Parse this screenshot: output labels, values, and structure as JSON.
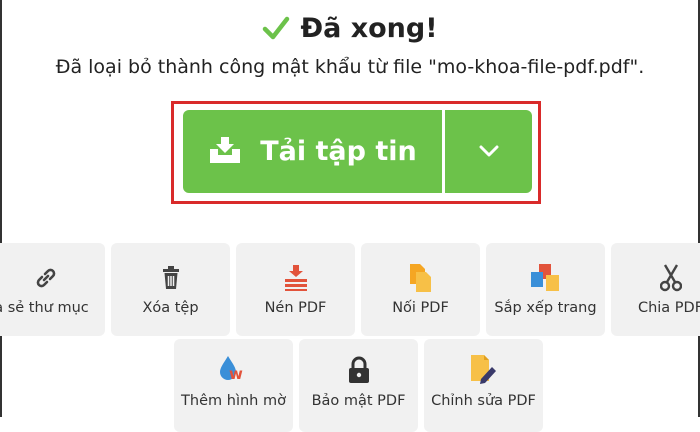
{
  "header": {
    "title": "Đã xong!",
    "message": "Đã loại bỏ thành công mật khẩu từ file \"mo-khoa-file-pdf.pdf\"."
  },
  "download": {
    "label": "Tải tập tin",
    "icon": "download-tray-icon",
    "dropdown_icon": "chevron-down-icon",
    "color": "#6cc24a",
    "highlight_color": "#d92a2a"
  },
  "tools_row1": [
    {
      "label": "hia sẻ thư mục",
      "icon": "link-icon"
    },
    {
      "label": "Xóa tệp",
      "icon": "trash-icon"
    },
    {
      "label": "Nén PDF",
      "icon": "compress-icon"
    },
    {
      "label": "Nối PDF",
      "icon": "merge-files-icon"
    },
    {
      "label": "Sắp xếp trang",
      "icon": "arrange-pages-icon"
    },
    {
      "label": "Chia PDF",
      "icon": "scissors-icon"
    }
  ],
  "tools_row2": [
    {
      "label": "Thêm hình mờ",
      "icon": "watermark-icon"
    },
    {
      "label": "Bảo mật PDF",
      "icon": "lock-icon"
    },
    {
      "label": "Chỉnh sửa PDF",
      "icon": "edit-file-icon"
    }
  ]
}
